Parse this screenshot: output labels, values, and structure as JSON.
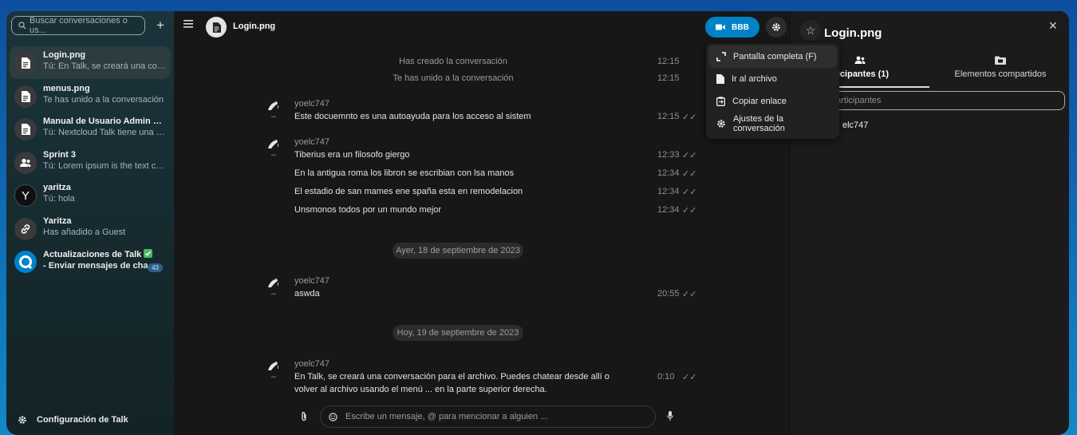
{
  "sidebar": {
    "search_placeholder": "Buscar conversaciones o us...",
    "add_label": "+",
    "conversations": [
      {
        "name": "Login.png",
        "subtitle": "Tú: En Talk, se creará una conv..."
      },
      {
        "name": "menus.png",
        "subtitle": "Te has unido a la conversación"
      },
      {
        "name": "Manual de Usuario Admin Co...",
        "subtitle": "Tú: Nextcloud Talk tiene una s..."
      },
      {
        "name": "Sprint 3",
        "subtitle": "Tú: Lorem ipsum is the text co..."
      },
      {
        "name": "yaritza",
        "subtitle": "Tú: hola",
        "avatar_letter": "Y"
      },
      {
        "name": "Yaritza",
        "subtitle": "Has añadido a Guest"
      },
      {
        "name": "Actualizaciones de Talk",
        "subtitle": "- Enviar mensajes de cha...",
        "unread": "43"
      }
    ],
    "settings_label": "Configuración de Talk"
  },
  "chat": {
    "title": "Login.png",
    "call_label": "BBB",
    "system_messages": [
      {
        "text": "Has creado la conversación",
        "time": "12:15"
      },
      {
        "text": "Te has unido a la conversación",
        "time": "12:15"
      }
    ],
    "groups": [
      {
        "author": "yoelc747",
        "messages": [
          {
            "text": "Este docuemnto es una autoayuda para los acceso al sistem",
            "time": "12:15"
          }
        ]
      },
      {
        "author": "yoelc747",
        "messages": [
          {
            "text": "Tiberius era un filosofo giergo",
            "time": "12:33"
          },
          {
            "text": "En la antigua roma los libron se escribian con lsa manos",
            "time": "12:34"
          },
          {
            "text": "El estadio de san mames ene spaña esta en remodelacion",
            "time": "12:34"
          },
          {
            "text": "Unsmonos todos por un mundo mejor",
            "time": "12:34"
          }
        ]
      },
      {
        "author": "yoelc747",
        "messages": [
          {
            "text": "aswda",
            "time": "20:55"
          }
        ]
      },
      {
        "author": "yoelc747",
        "messages": [
          {
            "text": "En Talk, se creará una conversación para el archivo. Puedes chatear desde allí o volver al archivo usando el menú ... en la parte superior derecha.",
            "time": "0:10"
          }
        ]
      }
    ],
    "date_separators": [
      "Ayer, 18 de septiembre de 2023",
      "Hoy, 19 de septiembre de 2023"
    ],
    "author_dash": "–",
    "composer_placeholder": "Escribe un mensaje, @ para mencionar a alguien ..."
  },
  "menu": {
    "items": [
      "Pantalla completa (F)",
      "Ir al archivo",
      "Copiar enlace",
      "Ajustes de la conversación"
    ]
  },
  "right_panel": {
    "title": "Login.png",
    "tabs": [
      "rticipantes (1)",
      "Elementos compartidos"
    ],
    "search_placeholder": "participantes",
    "participant": "elc747"
  },
  "colors": {
    "accent": "#0082c9",
    "success": "#46ba61",
    "background": "#171717"
  }
}
